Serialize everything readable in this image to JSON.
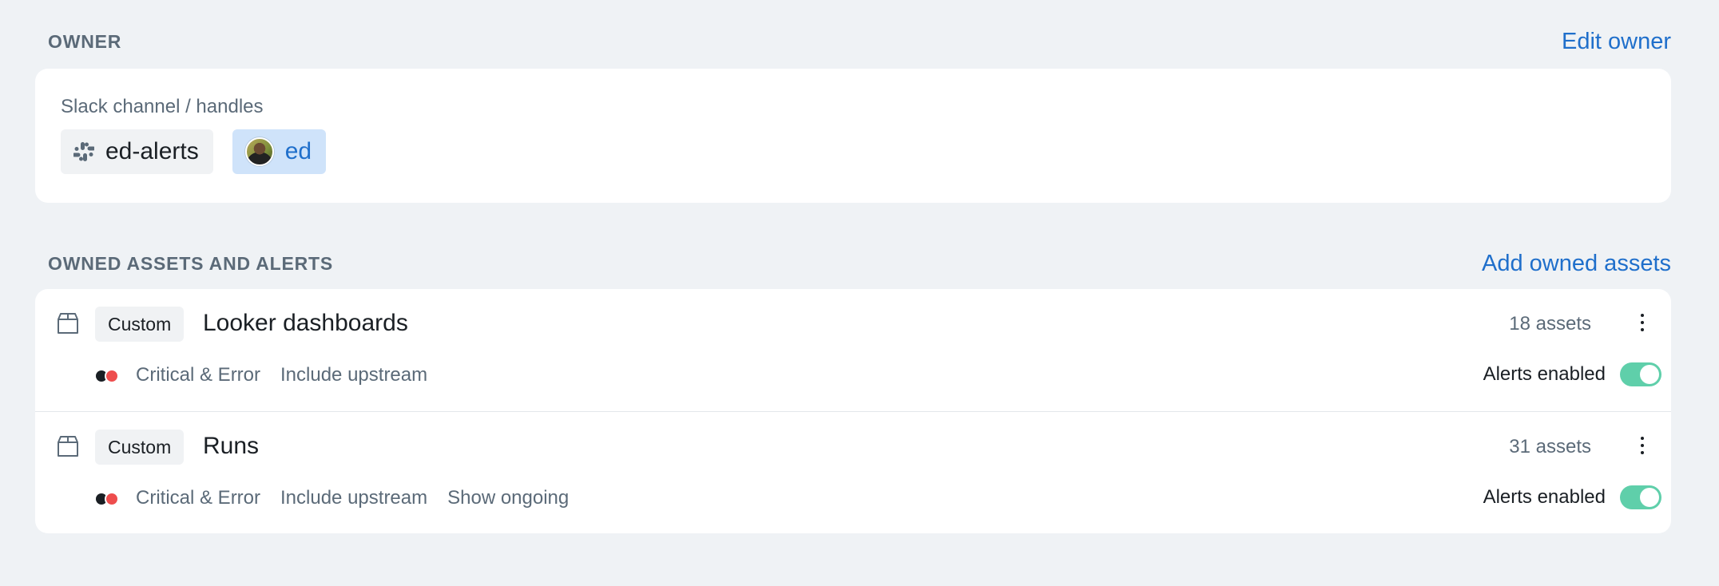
{
  "owner_section": {
    "title": "OWNER",
    "action": "Edit owner",
    "card": {
      "label": "Slack channel / handles",
      "chips": [
        {
          "icon": "slack-icon",
          "label": "ed-alerts"
        },
        {
          "icon": "avatar",
          "label": "ed"
        }
      ]
    }
  },
  "assets_section": {
    "title": "OWNED ASSETS AND ALERTS",
    "action": "Add owned assets",
    "rows": [
      {
        "icon": "box-icon",
        "type": "Custom",
        "name": "Looker dashboards",
        "count": "18 assets",
        "severity": "Critical & Error",
        "options": [
          "Include upstream"
        ],
        "alerts_label": "Alerts enabled",
        "alerts_enabled": true
      },
      {
        "icon": "box-icon",
        "type": "Custom",
        "name": "Runs",
        "count": "31 assets",
        "severity": "Critical & Error",
        "options": [
          "Include upstream",
          "Show ongoing"
        ],
        "alerts_label": "Alerts enabled",
        "alerts_enabled": true
      }
    ]
  },
  "colors": {
    "background": "#eff2f5",
    "link": "#1f6fcb",
    "toggle_on": "#5fcfaa",
    "severity_critical": "#1a1f24",
    "severity_error": "#ee4d4d",
    "user_chip": "#cfe3fa"
  }
}
